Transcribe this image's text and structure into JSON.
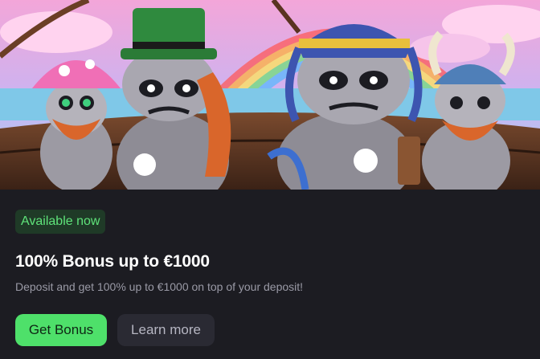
{
  "banner": {
    "image": "raccoon-pirates-illustration"
  },
  "offer": {
    "badge": "Available now",
    "title": "100% Bonus up to €1000",
    "description": "Deposit and get 100% up to €1000 on top of your deposit!"
  },
  "actions": {
    "primary_label": "Get Bonus",
    "secondary_label": "Learn more"
  },
  "colors": {
    "background": "#1c1c22",
    "accent": "#4ee06a",
    "badge_bg": "#1f3a27",
    "badge_text": "#5fe37a",
    "secondary_button": "#2a2a33"
  }
}
